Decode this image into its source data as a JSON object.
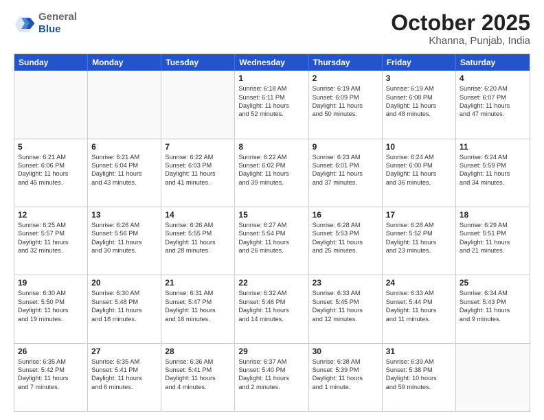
{
  "header": {
    "logo_general": "General",
    "logo_blue": "Blue",
    "month_title": "October 2025",
    "location": "Khanna, Punjab, India"
  },
  "weekdays": [
    "Sunday",
    "Monday",
    "Tuesday",
    "Wednesday",
    "Thursday",
    "Friday",
    "Saturday"
  ],
  "rows": [
    [
      {
        "day": "",
        "lines": [],
        "empty": true
      },
      {
        "day": "",
        "lines": [],
        "empty": true
      },
      {
        "day": "",
        "lines": [],
        "empty": true
      },
      {
        "day": "1",
        "lines": [
          "Sunrise: 6:18 AM",
          "Sunset: 6:11 PM",
          "Daylight: 11 hours",
          "and 52 minutes."
        ],
        "empty": false
      },
      {
        "day": "2",
        "lines": [
          "Sunrise: 6:19 AM",
          "Sunset: 6:09 PM",
          "Daylight: 11 hours",
          "and 50 minutes."
        ],
        "empty": false
      },
      {
        "day": "3",
        "lines": [
          "Sunrise: 6:19 AM",
          "Sunset: 6:08 PM",
          "Daylight: 11 hours",
          "and 48 minutes."
        ],
        "empty": false
      },
      {
        "day": "4",
        "lines": [
          "Sunrise: 6:20 AM",
          "Sunset: 6:07 PM",
          "Daylight: 11 hours",
          "and 47 minutes."
        ],
        "empty": false
      }
    ],
    [
      {
        "day": "5",
        "lines": [
          "Sunrise: 6:21 AM",
          "Sunset: 6:06 PM",
          "Daylight: 11 hours",
          "and 45 minutes."
        ],
        "empty": false
      },
      {
        "day": "6",
        "lines": [
          "Sunrise: 6:21 AM",
          "Sunset: 6:04 PM",
          "Daylight: 11 hours",
          "and 43 minutes."
        ],
        "empty": false
      },
      {
        "day": "7",
        "lines": [
          "Sunrise: 6:22 AM",
          "Sunset: 6:03 PM",
          "Daylight: 11 hours",
          "and 41 minutes."
        ],
        "empty": false
      },
      {
        "day": "8",
        "lines": [
          "Sunrise: 6:22 AM",
          "Sunset: 6:02 PM",
          "Daylight: 11 hours",
          "and 39 minutes."
        ],
        "empty": false
      },
      {
        "day": "9",
        "lines": [
          "Sunrise: 6:23 AM",
          "Sunset: 6:01 PM",
          "Daylight: 11 hours",
          "and 37 minutes."
        ],
        "empty": false
      },
      {
        "day": "10",
        "lines": [
          "Sunrise: 6:24 AM",
          "Sunset: 6:00 PM",
          "Daylight: 11 hours",
          "and 36 minutes."
        ],
        "empty": false
      },
      {
        "day": "11",
        "lines": [
          "Sunrise: 6:24 AM",
          "Sunset: 5:59 PM",
          "Daylight: 11 hours",
          "and 34 minutes."
        ],
        "empty": false
      }
    ],
    [
      {
        "day": "12",
        "lines": [
          "Sunrise: 6:25 AM",
          "Sunset: 5:57 PM",
          "Daylight: 11 hours",
          "and 32 minutes."
        ],
        "empty": false
      },
      {
        "day": "13",
        "lines": [
          "Sunrise: 6:26 AM",
          "Sunset: 5:56 PM",
          "Daylight: 11 hours",
          "and 30 minutes."
        ],
        "empty": false
      },
      {
        "day": "14",
        "lines": [
          "Sunrise: 6:26 AM",
          "Sunset: 5:55 PM",
          "Daylight: 11 hours",
          "and 28 minutes."
        ],
        "empty": false
      },
      {
        "day": "15",
        "lines": [
          "Sunrise: 6:27 AM",
          "Sunset: 5:54 PM",
          "Daylight: 11 hours",
          "and 26 minutes."
        ],
        "empty": false
      },
      {
        "day": "16",
        "lines": [
          "Sunrise: 6:28 AM",
          "Sunset: 5:53 PM",
          "Daylight: 11 hours",
          "and 25 minutes."
        ],
        "empty": false
      },
      {
        "day": "17",
        "lines": [
          "Sunrise: 6:28 AM",
          "Sunset: 5:52 PM",
          "Daylight: 11 hours",
          "and 23 minutes."
        ],
        "empty": false
      },
      {
        "day": "18",
        "lines": [
          "Sunrise: 6:29 AM",
          "Sunset: 5:51 PM",
          "Daylight: 11 hours",
          "and 21 minutes."
        ],
        "empty": false
      }
    ],
    [
      {
        "day": "19",
        "lines": [
          "Sunrise: 6:30 AM",
          "Sunset: 5:50 PM",
          "Daylight: 11 hours",
          "and 19 minutes."
        ],
        "empty": false
      },
      {
        "day": "20",
        "lines": [
          "Sunrise: 6:30 AM",
          "Sunset: 5:48 PM",
          "Daylight: 11 hours",
          "and 18 minutes."
        ],
        "empty": false
      },
      {
        "day": "21",
        "lines": [
          "Sunrise: 6:31 AM",
          "Sunset: 5:47 PM",
          "Daylight: 11 hours",
          "and 16 minutes."
        ],
        "empty": false
      },
      {
        "day": "22",
        "lines": [
          "Sunrise: 6:32 AM",
          "Sunset: 5:46 PM",
          "Daylight: 11 hours",
          "and 14 minutes."
        ],
        "empty": false
      },
      {
        "day": "23",
        "lines": [
          "Sunrise: 6:33 AM",
          "Sunset: 5:45 PM",
          "Daylight: 11 hours",
          "and 12 minutes."
        ],
        "empty": false
      },
      {
        "day": "24",
        "lines": [
          "Sunrise: 6:33 AM",
          "Sunset: 5:44 PM",
          "Daylight: 11 hours",
          "and 11 minutes."
        ],
        "empty": false
      },
      {
        "day": "25",
        "lines": [
          "Sunrise: 6:34 AM",
          "Sunset: 5:43 PM",
          "Daylight: 11 hours",
          "and 9 minutes."
        ],
        "empty": false
      }
    ],
    [
      {
        "day": "26",
        "lines": [
          "Sunrise: 6:35 AM",
          "Sunset: 5:42 PM",
          "Daylight: 11 hours",
          "and 7 minutes."
        ],
        "empty": false
      },
      {
        "day": "27",
        "lines": [
          "Sunrise: 6:35 AM",
          "Sunset: 5:41 PM",
          "Daylight: 11 hours",
          "and 6 minutes."
        ],
        "empty": false
      },
      {
        "day": "28",
        "lines": [
          "Sunrise: 6:36 AM",
          "Sunset: 5:41 PM",
          "Daylight: 11 hours",
          "and 4 minutes."
        ],
        "empty": false
      },
      {
        "day": "29",
        "lines": [
          "Sunrise: 6:37 AM",
          "Sunset: 5:40 PM",
          "Daylight: 11 hours",
          "and 2 minutes."
        ],
        "empty": false
      },
      {
        "day": "30",
        "lines": [
          "Sunrise: 6:38 AM",
          "Sunset: 5:39 PM",
          "Daylight: 11 hours",
          "and 1 minute."
        ],
        "empty": false
      },
      {
        "day": "31",
        "lines": [
          "Sunrise: 6:39 AM",
          "Sunset: 5:38 PM",
          "Daylight: 10 hours",
          "and 59 minutes."
        ],
        "empty": false
      },
      {
        "day": "",
        "lines": [],
        "empty": true
      }
    ]
  ]
}
